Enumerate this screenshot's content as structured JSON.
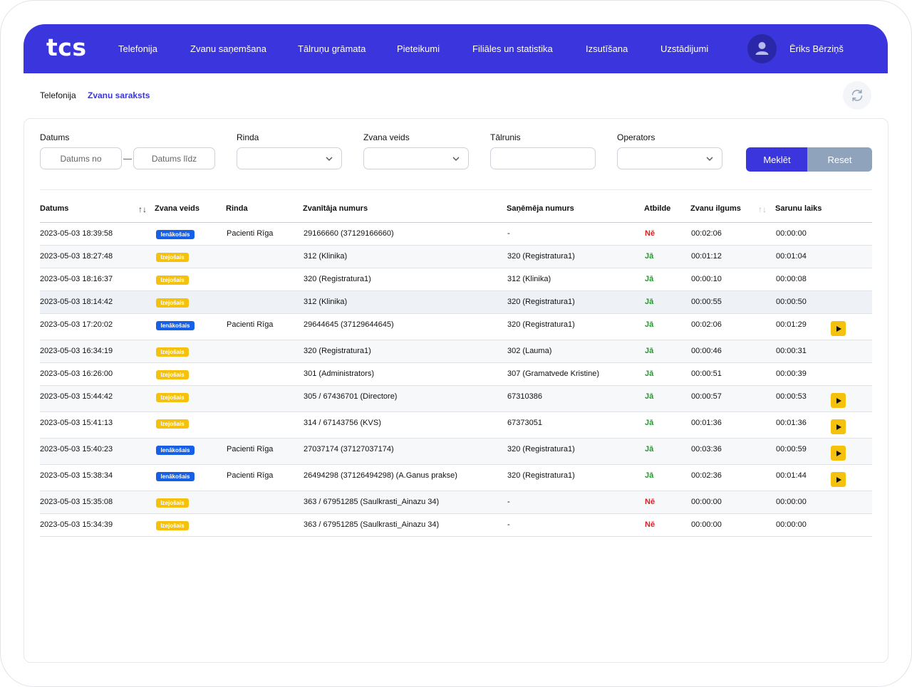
{
  "app": {
    "logo": "tcs",
    "user_name": "Ēriks Bērziņš"
  },
  "nav": [
    {
      "label": "Telefonija"
    },
    {
      "label": "Zvanu saņemšana"
    },
    {
      "label": "Tālruņu grāmata"
    },
    {
      "label": "Pieteikumi"
    },
    {
      "label": "Filiāles un statistika"
    },
    {
      "label": "Izsutīšana"
    },
    {
      "label": "Uzstādijumi"
    }
  ],
  "breadcrumb": {
    "parent": "Telefonija",
    "current": "Zvanu saraksts"
  },
  "filters": {
    "date_label": "Datums",
    "date_from_placeholder": "Datums no",
    "date_to_placeholder": "Datums līdz",
    "queue_label": "Rinda",
    "call_type_label": "Zvana veids",
    "phone_label": "Tālrunis",
    "operator_label": "Operators",
    "search_button": "Meklēt",
    "reset_button": "Reset"
  },
  "table": {
    "columns": {
      "date": "Datums",
      "call_type": "Zvana veids",
      "queue": "Rinda",
      "caller": "Zvanītāja numurs",
      "receiver": "Saņēmēja numurs",
      "answer": "Atbilde",
      "duration": "Zvanu ilgums",
      "talk_time": "Sarunu laiks"
    },
    "rows": [
      {
        "date": "2023-05-03 18:39:58",
        "type": "Ienākošais",
        "dir": "in",
        "queue": "Pacienti Rīga",
        "caller": "29166660 (37129166660)",
        "receiver": "-",
        "answer": "Nē",
        "ans": "no",
        "duration": "00:02:06",
        "talk": "00:00:00",
        "play": false
      },
      {
        "date": "2023-05-03 18:27:48",
        "type": "Izejošais",
        "dir": "out",
        "queue": "",
        "caller": "312 (Klinika)",
        "receiver": "320 (Registratura1)",
        "answer": "Jā",
        "ans": "yes",
        "duration": "00:01:12",
        "talk": "00:01:04",
        "play": false
      },
      {
        "date": "2023-05-03 18:16:37",
        "type": "Izejošais",
        "dir": "out",
        "queue": "",
        "caller": "320 (Registratura1)",
        "receiver": "312 (Klinika)",
        "answer": "Jā",
        "ans": "yes",
        "duration": "00:00:10",
        "talk": "00:00:08",
        "play": false
      },
      {
        "date": "2023-05-03 18:14:42",
        "type": "Izejošais",
        "dir": "out",
        "queue": "",
        "caller": "312 (Klinika)",
        "receiver": "320 (Registratura1)",
        "answer": "Jā",
        "ans": "yes",
        "duration": "00:00:55",
        "talk": "00:00:50",
        "play": false
      },
      {
        "date": "2023-05-03 17:20:02",
        "type": "Ienākošais",
        "dir": "in",
        "queue": "Pacienti Rīga",
        "caller": "29644645 (37129644645)",
        "receiver": "320 (Registratura1)",
        "answer": "Jā",
        "ans": "yes",
        "duration": "00:02:06",
        "talk": "00:01:29",
        "play": true
      },
      {
        "date": "2023-05-03 16:34:19",
        "type": "Izejošais",
        "dir": "out",
        "queue": "",
        "caller": "320 (Registratura1)",
        "receiver": "302 (Lauma)",
        "answer": "Jā",
        "ans": "yes",
        "duration": "00:00:46",
        "talk": "00:00:31",
        "play": false
      },
      {
        "date": "2023-05-03 16:26:00",
        "type": "Izejošais",
        "dir": "out",
        "queue": "",
        "caller": "301 (Administrators)",
        "receiver": "307 (Gramatvede Kristine)",
        "answer": "Jā",
        "ans": "yes",
        "duration": "00:00:51",
        "talk": "00:00:39",
        "play": false
      },
      {
        "date": "2023-05-03 15:44:42",
        "type": "Izejošais",
        "dir": "out",
        "queue": "",
        "caller": "305 / 67436701 (Directore)",
        "receiver": "67310386",
        "answer": "Jā",
        "ans": "yes",
        "duration": "00:00:57",
        "talk": "00:00:53",
        "play": true
      },
      {
        "date": "2023-05-03 15:41:13",
        "type": "Izejošais",
        "dir": "out",
        "queue": "",
        "caller": "314 / 67143756 (KVS)",
        "receiver": "67373051",
        "answer": "Jā",
        "ans": "yes",
        "duration": "00:01:36",
        "talk": "00:01:36",
        "play": true
      },
      {
        "date": "2023-05-03 15:40:23",
        "type": "Ienākošais",
        "dir": "in",
        "queue": "Pacienti Rīga",
        "caller": "27037174 (37127037174)",
        "receiver": "320 (Registratura1)",
        "answer": "Jā",
        "ans": "yes",
        "duration": "00:03:36",
        "talk": "00:00:59",
        "play": true
      },
      {
        "date": "2023-05-03 15:38:34",
        "type": "Ienākošais",
        "dir": "in",
        "queue": "Pacienti Rīga",
        "caller": "26494298 (37126494298) (A.Ganus prakse)",
        "receiver": "320 (Registratura1)",
        "answer": "Jā",
        "ans": "yes",
        "duration": "00:02:36",
        "talk": "00:01:44",
        "play": true
      },
      {
        "date": "2023-05-03 15:35:08",
        "type": "Izejošais",
        "dir": "out",
        "queue": "",
        "caller": "363 / 67951285 (Saulkrasti_Ainazu 34)",
        "receiver": "-",
        "answer": "Nē",
        "ans": "no",
        "duration": "00:00:00",
        "talk": "00:00:00",
        "play": false
      },
      {
        "date": "2023-05-03 15:34:39",
        "type": "Izejošais",
        "dir": "out",
        "queue": "",
        "caller": "363 / 67951285 (Saulkrasti_Ainazu 34)",
        "receiver": "-",
        "answer": "Nē",
        "ans": "no",
        "duration": "00:00:00",
        "talk": "00:00:00",
        "play": false
      }
    ]
  },
  "colors": {
    "brand": "#3a35dd",
    "incoming": "#1560e6",
    "outgoing": "#f4c20d",
    "yes": "#1f9a2a",
    "no": "#e02020"
  },
  "icons": {
    "user": "user-icon",
    "refresh": "refresh-icon",
    "sort": "sort-icon",
    "chevron": "chevron-down-icon",
    "play": "play-icon"
  }
}
